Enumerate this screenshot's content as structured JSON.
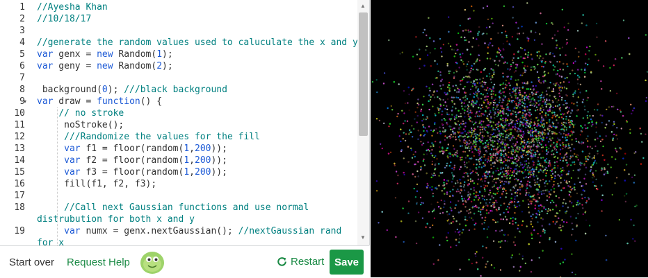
{
  "editor": {
    "lines": [
      {
        "num": "1",
        "tokens": [
          {
            "t": "//Ayesha Khan",
            "c": "com"
          }
        ]
      },
      {
        "num": "2",
        "tokens": [
          {
            "t": "//10/18/17",
            "c": "com"
          }
        ]
      },
      {
        "num": "3",
        "tokens": []
      },
      {
        "num": "4",
        "tokens": [
          {
            "t": "//generate the random values used to caluculate the x and y",
            "c": "com"
          }
        ]
      },
      {
        "num": "5",
        "tokens": [
          {
            "t": "var",
            "c": "kw"
          },
          {
            "t": " genx = ",
            "c": "plain"
          },
          {
            "t": "new",
            "c": "kw"
          },
          {
            "t": " Random(",
            "c": "plain"
          },
          {
            "t": "1",
            "c": "num"
          },
          {
            "t": ");",
            "c": "plain"
          }
        ]
      },
      {
        "num": "6",
        "tokens": [
          {
            "t": "var",
            "c": "kw"
          },
          {
            "t": " geny = ",
            "c": "plain"
          },
          {
            "t": "new",
            "c": "kw"
          },
          {
            "t": " Random(",
            "c": "plain"
          },
          {
            "t": "2",
            "c": "num"
          },
          {
            "t": ");",
            "c": "plain"
          }
        ]
      },
      {
        "num": "7",
        "tokens": []
      },
      {
        "num": "8",
        "tokens": [
          {
            "t": " background(",
            "c": "plain"
          },
          {
            "t": "0",
            "c": "num"
          },
          {
            "t": "); ",
            "c": "plain"
          },
          {
            "t": "///black background",
            "c": "com"
          }
        ]
      },
      {
        "num": "9",
        "fold": true,
        "tokens": [
          {
            "t": "var",
            "c": "kw"
          },
          {
            "t": " draw = ",
            "c": "plain"
          },
          {
            "t": "function",
            "c": "kw"
          },
          {
            "t": "() {",
            "c": "plain"
          }
        ]
      },
      {
        "num": "10",
        "tokens": [
          {
            "t": "    ",
            "c": "plain"
          },
          {
            "t": "// no stroke",
            "c": "com"
          }
        ]
      },
      {
        "num": "11",
        "tokens": [
          {
            "t": "     noStroke();",
            "c": "plain"
          }
        ]
      },
      {
        "num": "12",
        "tokens": [
          {
            "t": "     ",
            "c": "plain"
          },
          {
            "t": "///Randomize the values for the fill",
            "c": "com"
          }
        ]
      },
      {
        "num": "13",
        "tokens": [
          {
            "t": "     ",
            "c": "plain"
          },
          {
            "t": "var",
            "c": "kw"
          },
          {
            "t": " f1 = floor(random(",
            "c": "plain"
          },
          {
            "t": "1",
            "c": "num"
          },
          {
            "t": ",",
            "c": "plain"
          },
          {
            "t": "200",
            "c": "num"
          },
          {
            "t": "));",
            "c": "plain"
          }
        ]
      },
      {
        "num": "14",
        "tokens": [
          {
            "t": "     ",
            "c": "plain"
          },
          {
            "t": "var",
            "c": "kw"
          },
          {
            "t": " f2 = floor(random(",
            "c": "plain"
          },
          {
            "t": "1",
            "c": "num"
          },
          {
            "t": ",",
            "c": "plain"
          },
          {
            "t": "200",
            "c": "num"
          },
          {
            "t": "));",
            "c": "plain"
          }
        ]
      },
      {
        "num": "15",
        "tokens": [
          {
            "t": "     ",
            "c": "plain"
          },
          {
            "t": "var",
            "c": "kw"
          },
          {
            "t": " f3 = floor(random(",
            "c": "plain"
          },
          {
            "t": "1",
            "c": "num"
          },
          {
            "t": ",",
            "c": "plain"
          },
          {
            "t": "200",
            "c": "num"
          },
          {
            "t": "));",
            "c": "plain"
          }
        ]
      },
      {
        "num": "16",
        "tokens": [
          {
            "t": "     fill(f1, f2, f3);",
            "c": "plain"
          }
        ]
      },
      {
        "num": "17",
        "tokens": []
      },
      {
        "num": "18",
        "tokens": [
          {
            "t": "     ",
            "c": "plain"
          },
          {
            "t": "//Call next Gaussian functions and use normal",
            "c": "com"
          }
        ]
      },
      {
        "num": "",
        "tokens": [
          {
            "t": "distrubution for both x and y",
            "c": "com"
          }
        ]
      },
      {
        "num": "19",
        "tokens": [
          {
            "t": "     ",
            "c": "plain"
          },
          {
            "t": "var",
            "c": "kw"
          },
          {
            "t": " numx = genx.nextGaussian(); ",
            "c": "plain"
          },
          {
            "t": "//nextGaussian rand",
            "c": "com"
          }
        ]
      },
      {
        "num": "",
        "tokens": [
          {
            "t": "for x",
            "c": "com"
          }
        ]
      }
    ]
  },
  "footer": {
    "start_over": "Start over",
    "request_help": "Request Help",
    "restart": "Restart",
    "save": "Save"
  },
  "colors": {
    "accent_green": "#1b8a45",
    "save_bg": "#1b9846",
    "comment": "#008080",
    "keyword": "#1d5ad6",
    "canvas_bg": "#000000"
  },
  "icons": {
    "restart": "restart-icon",
    "avatar": "green-blob-avatar-icon",
    "scroll_up": "scroll-up-arrow-icon",
    "scroll_down": "scroll-down-arrow-icon",
    "fold": "fold-arrow-icon"
  },
  "canvas": {
    "background": "black",
    "content": "gaussian-distributed random colored dots"
  }
}
